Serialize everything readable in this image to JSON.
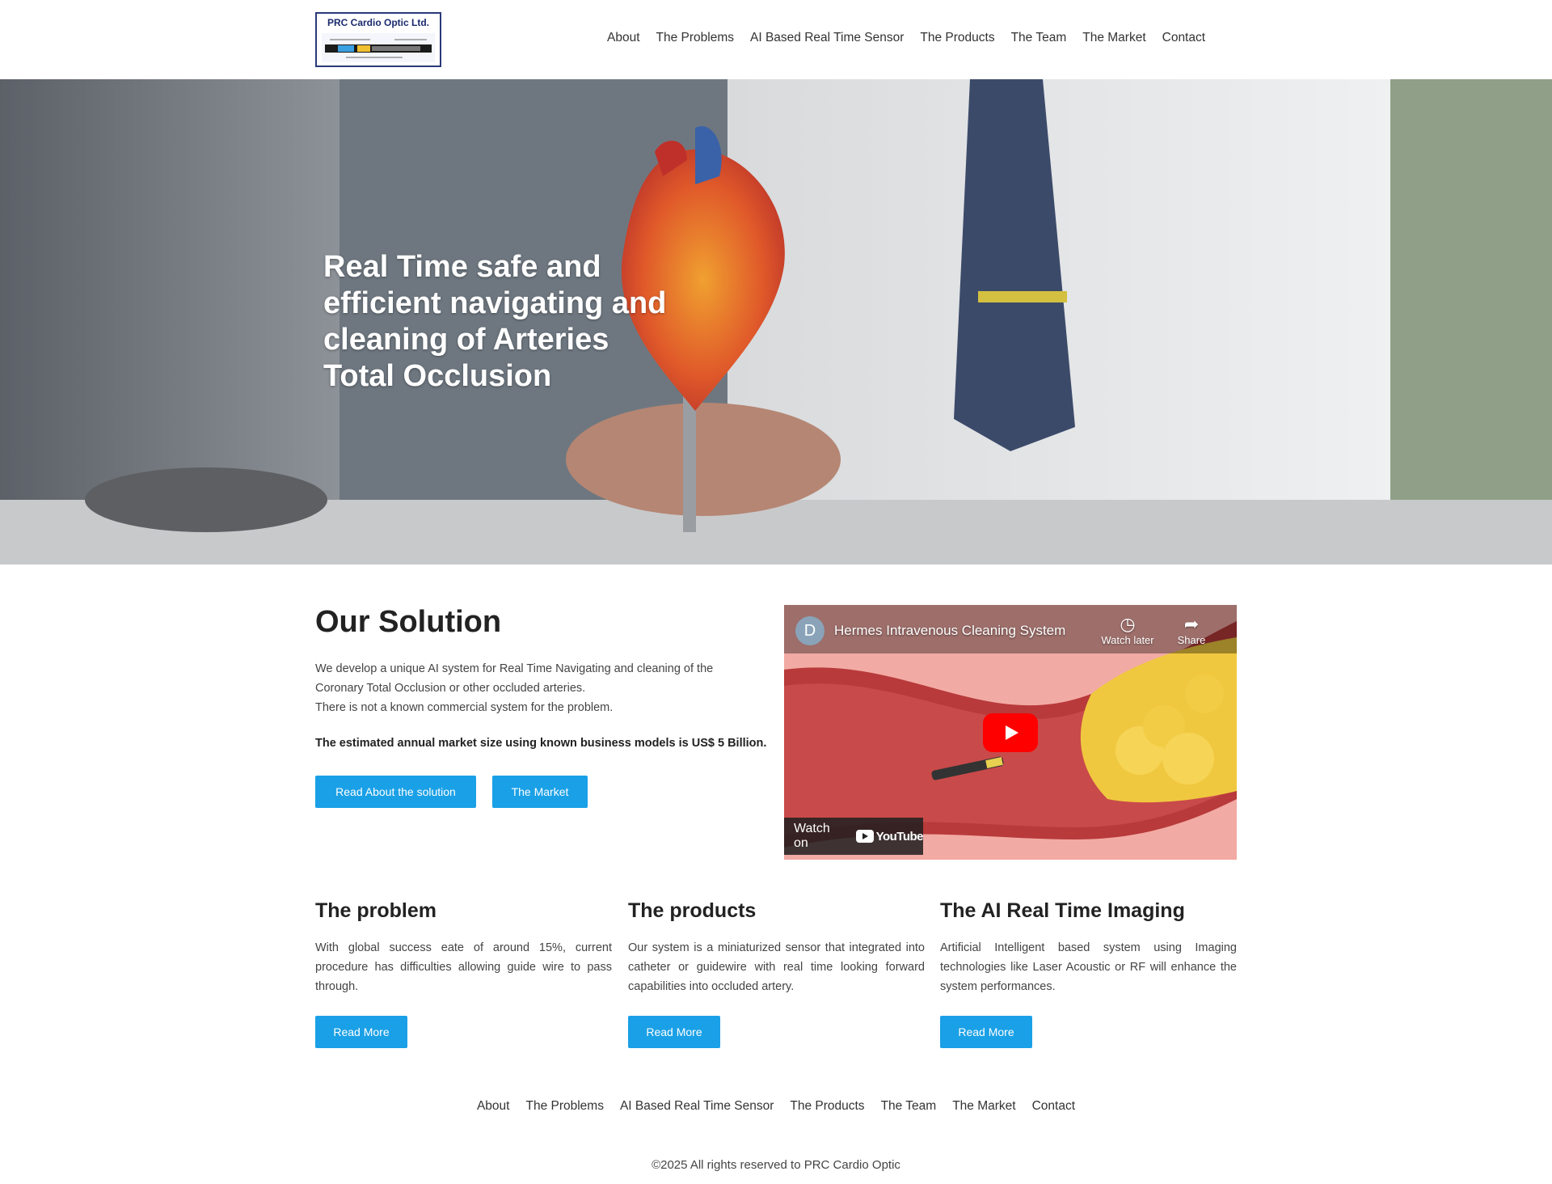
{
  "brand": {
    "logo_text": "PRC Cardio Optic Ltd."
  },
  "nav": [
    "About",
    "The Problems",
    "AI Based Real Time Sensor",
    "The Products",
    "The Team",
    "The Market",
    "Contact"
  ],
  "hero": {
    "title": "Real Time safe and efficient navigating and cleaning of Arteries Total Occlusion"
  },
  "solution": {
    "title": "Our Solution",
    "line1": "We develop a unique AI system for Real Time Navigating and cleaning of the",
    "line2": "Coronary Total Occlusion or other occluded arteries.",
    "line3": "There is not a known commercial system for the problem.",
    "bold": "The estimated annual market size using known business models is US$ 5 Billion.",
    "btn_read": "Read About the solution",
    "btn_market": "The Market"
  },
  "video": {
    "avatar_letter": "D",
    "title": "Hermes Intravenous Cleaning System",
    "watch_later": "Watch later",
    "share": "Share",
    "watch_on": "Watch on",
    "youtube": "YouTube"
  },
  "columns": [
    {
      "title": "The problem",
      "text": "With global success eate of around 15%, current procedure has difficulties allowing guide wire to pass through.",
      "button": "Read More"
    },
    {
      "title": "The products",
      "text": "Our system is a miniaturized sensor that integrated into catheter or guidewire with real time looking forward capabilities into occluded artery.",
      "button": "Read More"
    },
    {
      "title": "The AI Real Time Imaging",
      "text": "Artificial Intelligent based system using Imaging technologies like Laser Acoustic or RF will enhance the system performances.",
      "button": "Read More"
    }
  ],
  "footer": {
    "nav": [
      "About",
      "The Problems",
      "AI Based Real Time Sensor",
      "The Products",
      "The Team",
      "The Market",
      "Contact"
    ],
    "copyright": "©2025 All rights reserved to PRC Cardio Optic"
  },
  "colors": {
    "accent": "#1aa0e6",
    "text": "#222222"
  },
  "icons": [
    "clock-icon",
    "share-icon",
    "play-icon",
    "youtube-logo-icon"
  ]
}
